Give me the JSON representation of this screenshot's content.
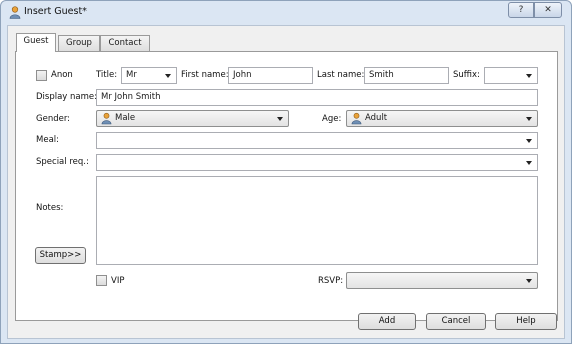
{
  "window": {
    "title": "Insert Guest*",
    "help_glyph": "?",
    "close_glyph": "✕"
  },
  "tabs": [
    {
      "label": "Guest",
      "active": true
    },
    {
      "label": "Group",
      "active": false
    },
    {
      "label": "Contact",
      "active": false
    }
  ],
  "form": {
    "anon_label": "Anon",
    "anon_checked": false,
    "title_label": "Title:",
    "title_value": "Mr",
    "first_name_label": "First name:",
    "first_name_value": "John",
    "last_name_label": "Last name:",
    "last_name_value": "Smith",
    "suffix_label": "Suffix:",
    "suffix_value": "",
    "display_name_label": "Display name:",
    "display_name_value": "Mr John Smith",
    "gender_label": "Gender:",
    "gender_value": "Male",
    "age_label": "Age:",
    "age_value": "Adult",
    "meal_label": "Meal:",
    "meal_value": "",
    "special_req_label": "Special req.:",
    "special_req_value": "",
    "notes_label": "Notes:",
    "notes_value": "",
    "stamp_label": "Stamp>>",
    "vip_label": "VIP",
    "vip_checked": false,
    "rsvp_label": "RSVP:",
    "rsvp_value": ""
  },
  "footer": {
    "add_label": "Add",
    "cancel_label": "Cancel",
    "help_label": "Help"
  },
  "icons": {
    "window": "person-icon",
    "gender": "person-icon",
    "age": "person-icon"
  },
  "colors": {
    "frame": "#dbe6f3",
    "person_head": "#e9a23a",
    "person_body": "#6f8fb5"
  }
}
